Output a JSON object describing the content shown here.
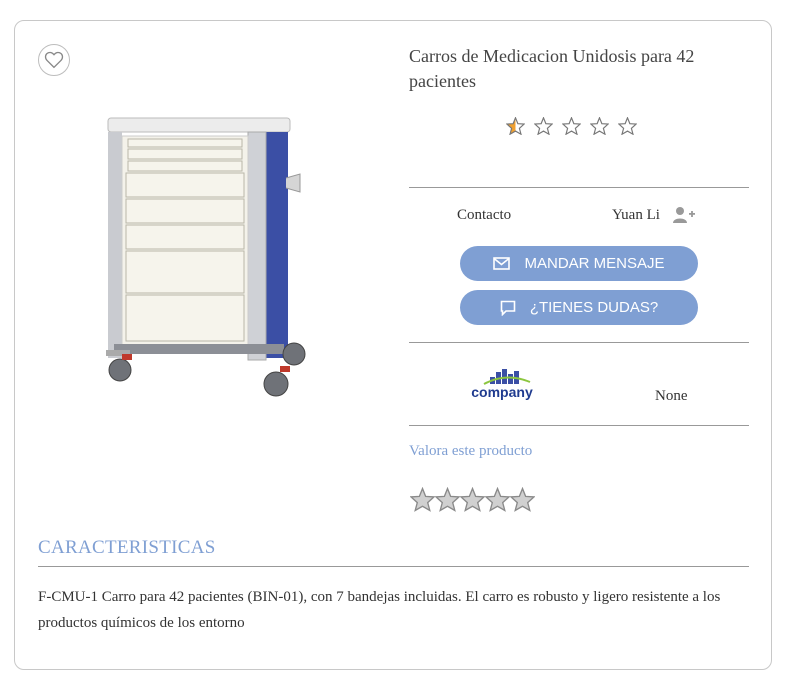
{
  "product": {
    "title": "Carros de Medicacion Unidosis para 42 pacientes",
    "rating": 0.5,
    "rating_max": 5
  },
  "contact": {
    "label": "Contacto",
    "name": "Yuan Li"
  },
  "buttons": {
    "message": "MANDAR MENSAJE",
    "questions": "¿TIENES DUDAS?"
  },
  "company": {
    "logo_text": "company",
    "value": "None"
  },
  "rate": {
    "link": "Valora este producto",
    "value": 0
  },
  "characteristics": {
    "title": "CARACTERISTICAS",
    "description": "F-CMU-1 Carro para 42 pacientes (BIN-01), con 7 bandejas incluidas. El carro es robusto y ligero resistente a los productos químicos de los entorno"
  },
  "colors": {
    "accent": "#7f9fd3",
    "star_fill": "#f0a030",
    "cart_blue": "#3b4fa5"
  },
  "icons": [
    "heart-icon",
    "star-icon",
    "add-user-icon",
    "envelope-icon",
    "chat-icon"
  ]
}
